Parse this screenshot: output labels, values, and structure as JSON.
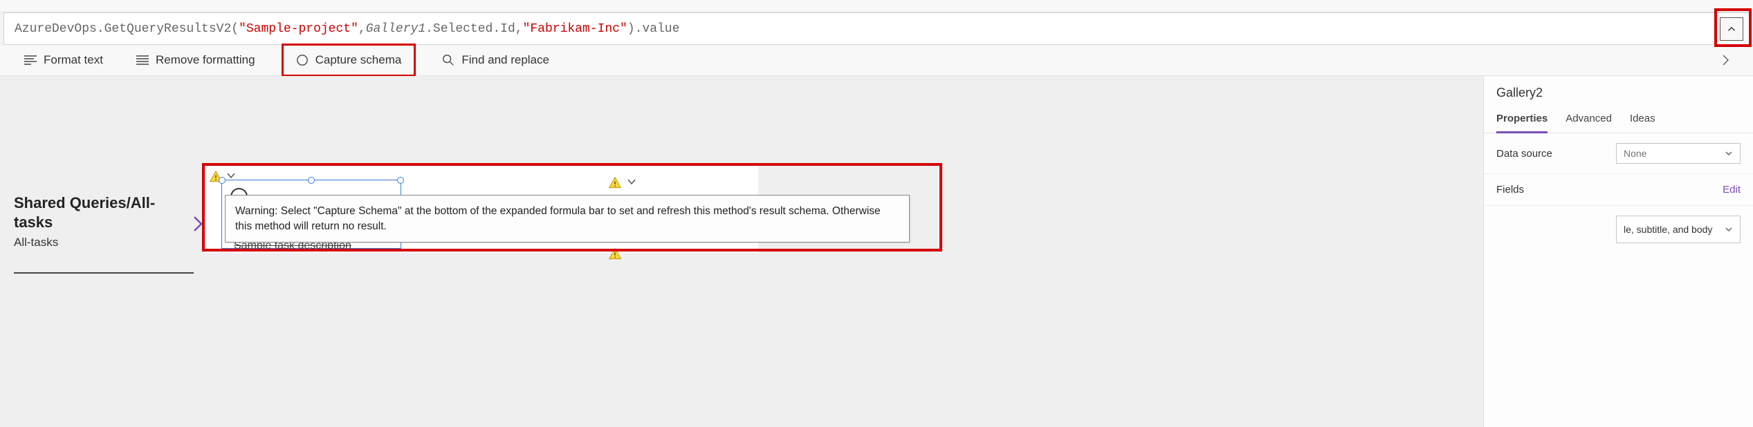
{
  "formula": {
    "full_text": "AzureDevOps.GetQueryResultsV2(\"Sample-project\",Gallery1.Selected.Id,\"Fabrikam-Inc\").value",
    "fn_prefix": "AzureDevOps.GetQueryResultsV2(",
    "str1": "\"Sample-project\"",
    "comma1": ",",
    "gallery_ref": "Gallery1",
    "selected": ".Selected.Id,",
    "str2": "\"Fabrikam-Inc\"",
    "after": ").value"
  },
  "toolbar": {
    "format_text": "Format text",
    "remove_formatting": "Remove formatting",
    "capture_schema": "Capture schema",
    "find_replace": "Find and replace"
  },
  "left_panel": {
    "title_line1": "Shared Queries/All-",
    "title_line2": "tasks",
    "subtitle": "All-tasks"
  },
  "tooltip": "Warning: Select \"Capture Schema\" at the bottom of the expanded formula bar to set and refresh this method's result schema. Otherwise this method will return no result.",
  "sample_task": "Sample task description",
  "props": {
    "title": "Gallery2",
    "tabs": {
      "properties": "Properties",
      "advanced": "Advanced",
      "ideas": "Ideas"
    },
    "data_source_label": "Data source",
    "data_source_value": "None",
    "fields_label": "Fields",
    "edit_label": "Edit",
    "layout_value": "le, subtitle, and body"
  }
}
